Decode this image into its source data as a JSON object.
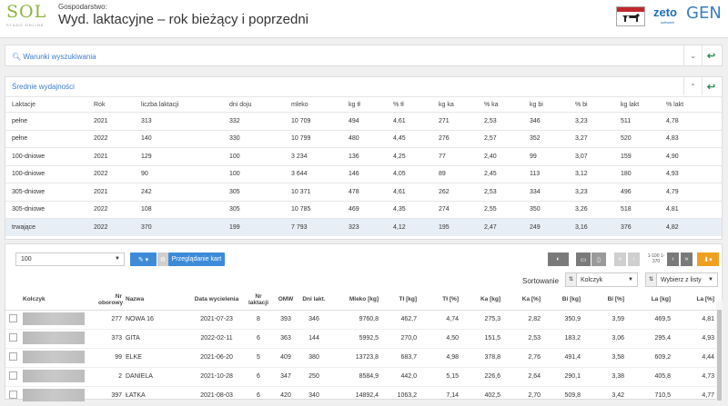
{
  "header": {
    "logo_text": "SOL",
    "logo_sub": "STADO ONLINE",
    "farm_label": "Gospodarstwo:",
    "title": "Wyd. laktacyjne – rok bieżący i poprzedni",
    "brand_zeto": "zeto",
    "brand_zeto_sub": "software",
    "brand_gen": "GEN"
  },
  "search_panel": {
    "title": "Warunki wyszukiwania"
  },
  "avg_panel": {
    "title": "Średnie wydajności",
    "columns": [
      "Laktacje",
      "Rok",
      "liczba laktacji",
      "dni doju",
      "mleko",
      "kg tł",
      "% tł",
      "kg ka",
      "% ka",
      "kg bi",
      "% bi",
      "kg lakt",
      "% lakt"
    ],
    "rows": [
      [
        "pełne",
        "2021",
        "313",
        "332",
        "10 709",
        "494",
        "4,61",
        "271",
        "2,53",
        "346",
        "3,23",
        "511",
        "4,78"
      ],
      [
        "pełne",
        "2022",
        "140",
        "330",
        "10 799",
        "480",
        "4,45",
        "276",
        "2,57",
        "352",
        "3,27",
        "520",
        "4,83"
      ],
      [
        "100-dniowe",
        "2021",
        "129",
        "100",
        "3 234",
        "136",
        "4,25",
        "77",
        "2,40",
        "99",
        "3,07",
        "159",
        "4,90"
      ],
      [
        "100-dniowe",
        "2022",
        "90",
        "100",
        "3 644",
        "146",
        "4,05",
        "89",
        "2,45",
        "113",
        "3,12",
        "180",
        "4,93"
      ],
      [
        "305-dniowe",
        "2021",
        "242",
        "305",
        "10 371",
        "478",
        "4,61",
        "262",
        "2,53",
        "334",
        "3,23",
        "496",
        "4,79"
      ],
      [
        "305-dniowe",
        "2022",
        "108",
        "305",
        "10 785",
        "469",
        "4,35",
        "274",
        "2,55",
        "350",
        "3,26",
        "518",
        "4,81"
      ],
      [
        "trwające",
        "2022",
        "370",
        "199",
        "7 793",
        "323",
        "4,12",
        "195",
        "2,47",
        "249",
        "3,16",
        "376",
        "4,82"
      ]
    ]
  },
  "grid_panel": {
    "page_size": "100",
    "browse_label": "Przeglądanie kart",
    "page_info": "1-100 1-370",
    "sort_label": "Sortowanie",
    "sort_primary": "Kolczyk",
    "sort_secondary": "Wybierz z listy",
    "columns": [
      "",
      "Kolczyk",
      "Nr oborowy",
      "Nazwa",
      "Data wycielenia",
      "Nr laktacji",
      "OMW",
      "Dni lakt.",
      "Mleko [kg]",
      "Tł [kg]",
      "Tł [%]",
      "Ka [kg]",
      "Ka [%]",
      "Bi [kg]",
      "Bi [%]",
      "La [kg]",
      "La [%]"
    ],
    "rows": [
      [
        "277",
        "NOWA 16",
        "2021-07-23",
        "8",
        "393",
        "346",
        "9760,8",
        "462,7",
        "4,74",
        "275,3",
        "2,82",
        "350,9",
        "3,59",
        "469,5",
        "4,81"
      ],
      [
        "373",
        "GITA",
        "2022-02-11",
        "6",
        "363",
        "144",
        "5992,5",
        "270,0",
        "4,50",
        "151,5",
        "2,53",
        "183,2",
        "3,06",
        "295,4",
        "4,93"
      ],
      [
        "99",
        "ELKE",
        "2021-06-20",
        "5",
        "409",
        "380",
        "13723,8",
        "683,7",
        "4,98",
        "378,8",
        "2,76",
        "491,4",
        "3,58",
        "609,2",
        "4,44"
      ],
      [
        "2",
        "DANIELA",
        "2021-10-28",
        "6",
        "347",
        "250",
        "8584,9",
        "442,0",
        "5,15",
        "226,6",
        "2,64",
        "290,1",
        "3,38",
        "405,8",
        "4,73"
      ],
      [
        "397",
        "ŁATKA",
        "2021-08-03",
        "6",
        "420",
        "340",
        "14892,4",
        "1063,2",
        "7,14",
        "402,5",
        "2,70",
        "509,8",
        "3,42",
        "710,5",
        "4,77"
      ]
    ]
  }
}
